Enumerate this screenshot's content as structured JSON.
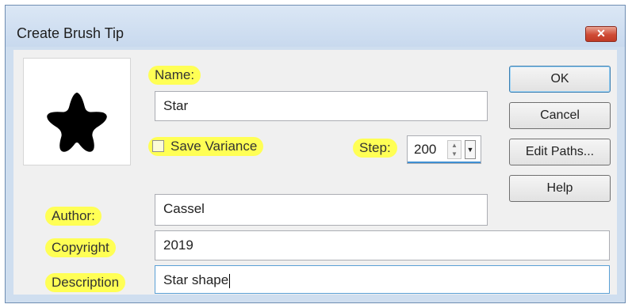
{
  "window": {
    "title": "Create Brush Tip",
    "close_glyph": "✕"
  },
  "preview": {
    "icon": "star-brush-icon"
  },
  "name": {
    "label": "Name:",
    "value": "Star"
  },
  "save_variance": {
    "label": "Save Variance",
    "checked": false
  },
  "step": {
    "label": "Step:",
    "value": "200"
  },
  "author": {
    "label": "Author:",
    "value": "Cassel"
  },
  "copyright": {
    "label": "Copyright",
    "value": "2019"
  },
  "description": {
    "label": "Description",
    "value": "Star shape"
  },
  "buttons": {
    "ok": "OK",
    "cancel": "Cancel",
    "edit_paths": "Edit Paths...",
    "help": "Help"
  },
  "colors": {
    "highlight": "#ffff55",
    "titlebar": "#cfdeef",
    "close": "#cf4b35"
  }
}
